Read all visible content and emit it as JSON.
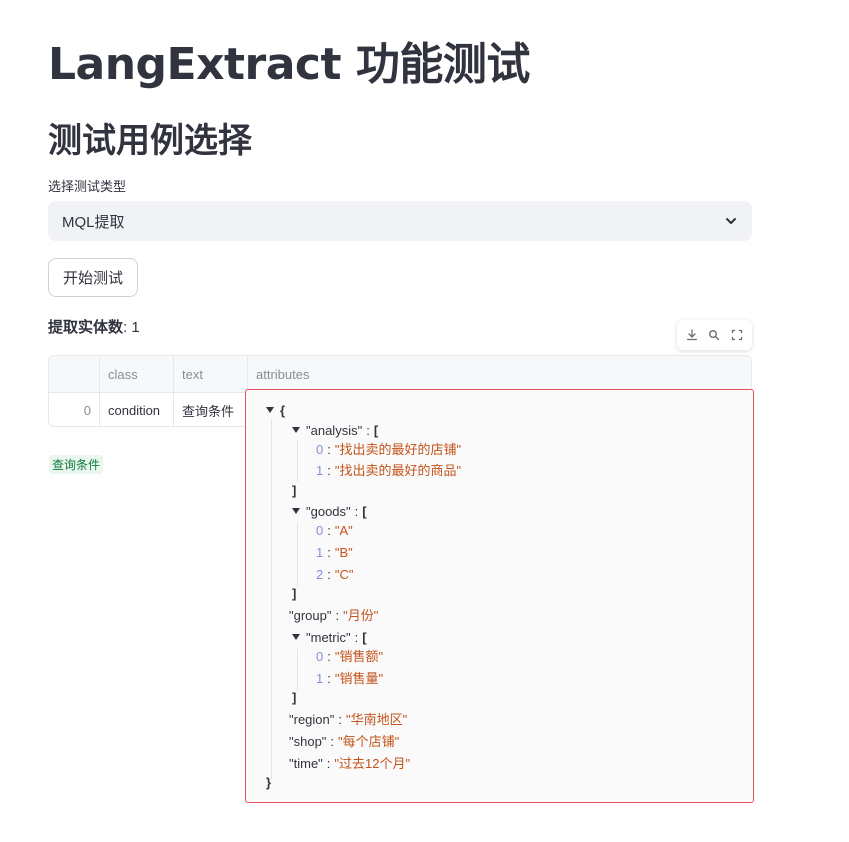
{
  "page": {
    "title": "LangExtract 功能测试",
    "subtitle": "测试用例选择"
  },
  "select": {
    "label": "选择测试类型",
    "value": "MQL提取"
  },
  "run_button": {
    "label": "开始测试"
  },
  "count": {
    "label": "提取实体数",
    "sep": ": ",
    "value": "1"
  },
  "toolbar": {
    "icons": [
      "download-icon",
      "search-icon",
      "fullscreen-icon"
    ]
  },
  "table": {
    "columns": [
      "",
      "class",
      "text",
      "attributes"
    ],
    "rows": [
      {
        "index": "0",
        "class": "condition",
        "text": "查询条件"
      }
    ]
  },
  "highlight_tag": "查询条件",
  "json_viewer": {
    "open_brace": "{",
    "close_brace": "}",
    "open_bracket": "[",
    "close_bracket": "]",
    "colon": ":",
    "analysis": {
      "key": "\"analysis\"",
      "items": [
        {
          "i": "0",
          "v": "\"找出卖的最好的店铺\""
        },
        {
          "i": "1",
          "v": "\"找出卖的最好的商品\""
        }
      ]
    },
    "goods": {
      "key": "\"goods\"",
      "items": [
        {
          "i": "0",
          "v": "\"A\""
        },
        {
          "i": "1",
          "v": "\"B\""
        },
        {
          "i": "2",
          "v": "\"C\""
        }
      ]
    },
    "group": {
      "key": "\"group\"",
      "v": "\"月份\""
    },
    "metric": {
      "key": "\"metric\"",
      "items": [
        {
          "i": "0",
          "v": "\"销售额\""
        },
        {
          "i": "1",
          "v": "\"销售量\""
        }
      ]
    },
    "region": {
      "key": "\"region\"",
      "v": "\"华南地区\""
    },
    "shop": {
      "key": "\"shop\"",
      "v": "\"每个店铺\""
    },
    "time": {
      "key": "\"time\"",
      "v": "\"过去12个月\""
    }
  }
}
